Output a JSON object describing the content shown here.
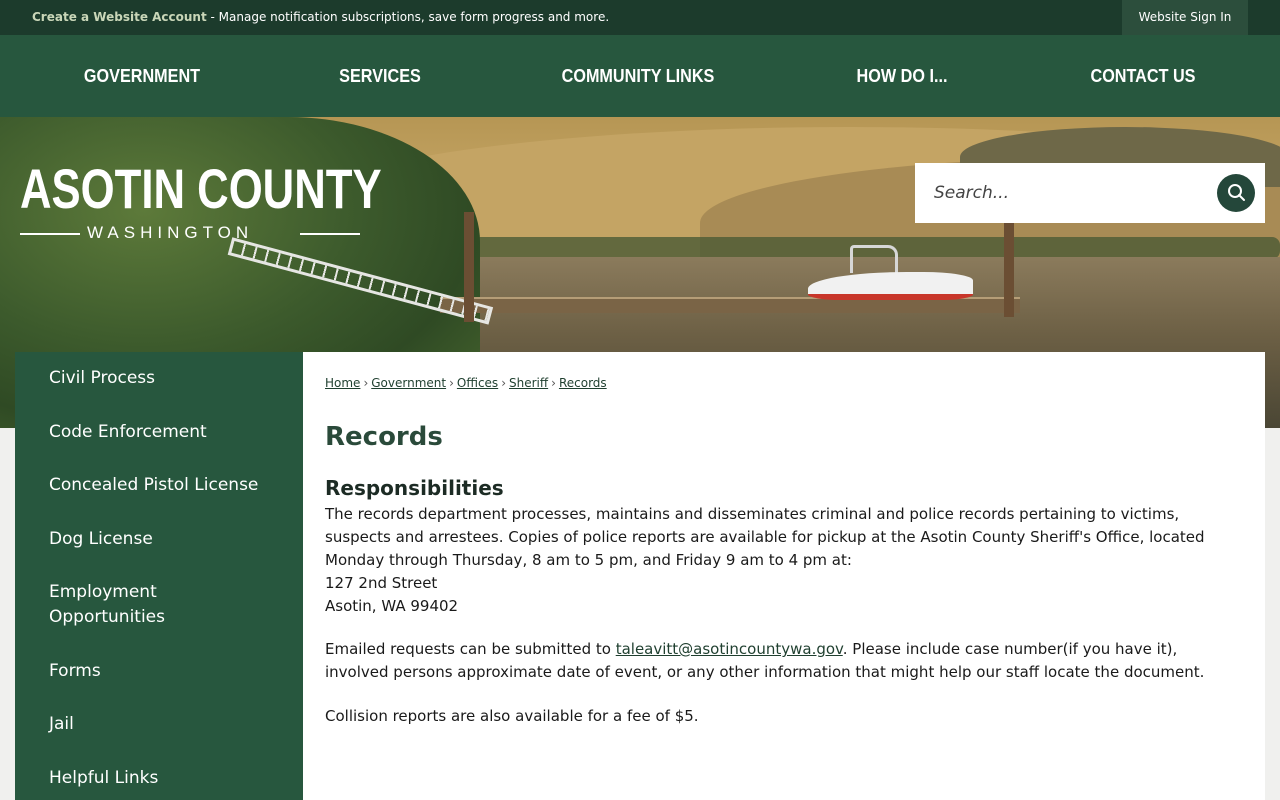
{
  "topbar": {
    "account_link": "Create a Website Account",
    "account_text": " - Manage notification subscriptions, save form progress and more.",
    "signin": "Website Sign In"
  },
  "nav": {
    "items": [
      "GOVERNMENT",
      "SERVICES",
      "COMMUNITY LINKS",
      "HOW DO I...",
      "CONTACT US"
    ]
  },
  "hero": {
    "logo_title": "ASOTIN COUNTY",
    "logo_subtitle": "WASHINGTON"
  },
  "search": {
    "placeholder": "Search..."
  },
  "sidebar": {
    "items": [
      "Civil Process",
      "Code Enforcement",
      "Concealed Pistol License",
      "Dog License",
      "Employment Opportunities",
      "Forms",
      "Jail",
      "Helpful Links"
    ]
  },
  "breadcrumb": [
    "Home",
    "Government",
    "Offices",
    "Sheriff",
    "Records"
  ],
  "content": {
    "title": "Records",
    "section_title": "Responsibilities",
    "paragraph1": "The records department processes, maintains and disseminates criminal and police records pertaining to victims, suspects and arrestees. Copies of police reports are available for pickup at the Asotin County Sheriff's Office, located Monday through Thursday, 8 am to 5 pm, and Friday 9 am to 4 pm at:",
    "address_line1": "127 2nd Street",
    "address_line2": "Asotin, WA 99402",
    "email_prefix": "Emailed requests can be submitted to ",
    "email": "taleavitt@asotincountywa.gov",
    "email_suffix": ". Please include case number(if you have it), involved persons approximate date of event, or any other information that might help our staff locate the document.",
    "paragraph3": "Collision reports are also available for a fee of $5."
  },
  "colors": {
    "primary_green": "#27573e",
    "dark_green": "#1c3b2c"
  }
}
